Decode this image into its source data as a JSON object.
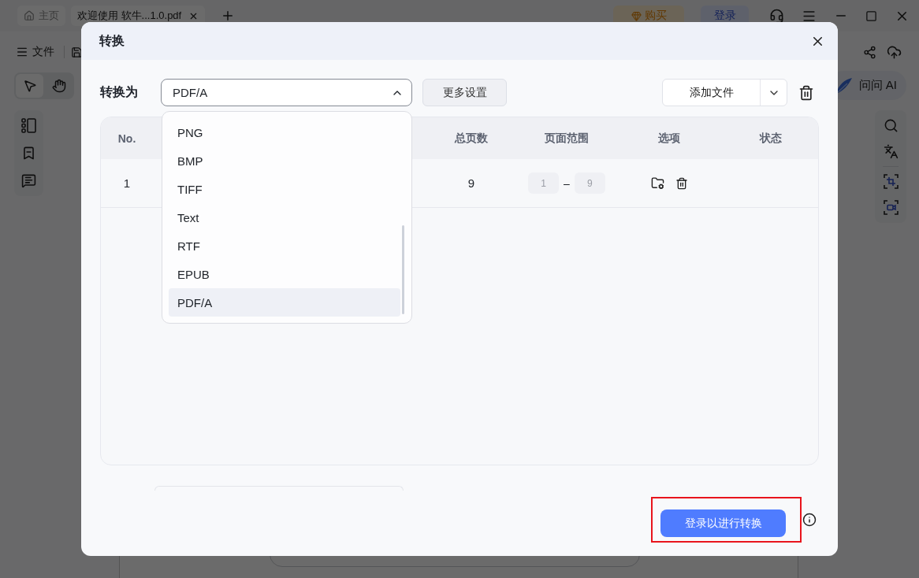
{
  "app": {
    "tabs": [
      {
        "kind": "home",
        "label": "主页",
        "selected": false
      },
      {
        "kind": "document",
        "label": "欢迎使用 软牛...1.0.pdf",
        "selected": true
      }
    ],
    "buy_button": "购买",
    "login_button": "登录",
    "file_menu": "文件",
    "tools": [
      {
        "kind": "select",
        "selected": true
      },
      {
        "kind": "hand",
        "selected": false
      }
    ],
    "ai_button": "问问 AI"
  },
  "dialog": {
    "title": "转换",
    "convert_to": {
      "label": "转换为",
      "value": "PDF/A",
      "expanded": true
    },
    "more_settings_button": "更多设置",
    "add_file_button": "添加文件",
    "format_options": [
      {
        "label": "PNG",
        "selected": false
      },
      {
        "label": "BMP",
        "selected": false
      },
      {
        "label": "TIFF",
        "selected": false
      },
      {
        "label": "Text",
        "selected": false
      },
      {
        "label": "RTF",
        "selected": false
      },
      {
        "label": "EPUB",
        "selected": false
      },
      {
        "label": "PDF/A",
        "selected": true
      }
    ],
    "table": {
      "columns": [
        "No.",
        "总页数",
        "页面范围",
        "选项",
        "状态"
      ],
      "rows": [
        {
          "no": "1",
          "pages": "9",
          "range": {
            "from": "1",
            "separator": "–",
            "to": "9",
            "disabled": true
          }
        }
      ]
    },
    "convert_button": {
      "label": "登录以进行转换",
      "highlighted": true
    }
  }
}
